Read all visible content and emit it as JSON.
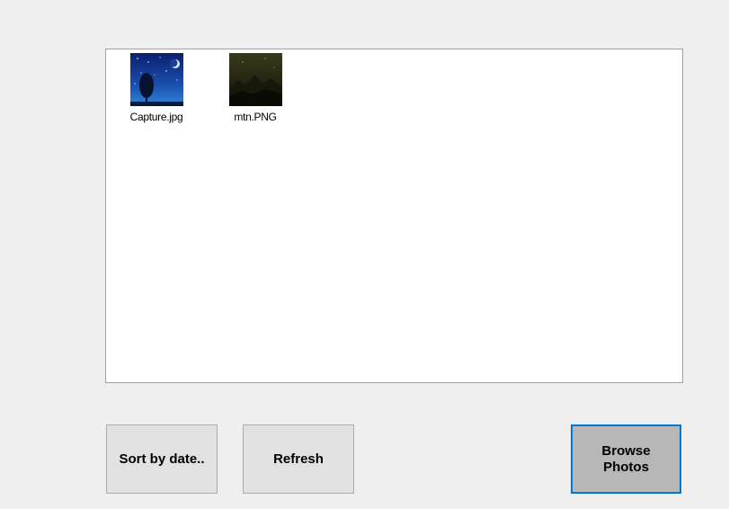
{
  "photos": [
    {
      "name": "Capture.jpg",
      "thumb_icon": "night-sky-tree-thumbnail"
    },
    {
      "name": "mtn.PNG",
      "thumb_icon": "mountain-night-thumbnail"
    }
  ],
  "buttons": {
    "sort_label": "Sort by date..",
    "refresh_label": "Refresh",
    "browse_label": "Browse Photos"
  },
  "colors": {
    "window_bg": "#efefef",
    "list_bg": "#ffffff",
    "button_bg": "#e1e1e1",
    "focused_button_bg": "#b7b7b7",
    "focus_border": "#0078d7"
  }
}
